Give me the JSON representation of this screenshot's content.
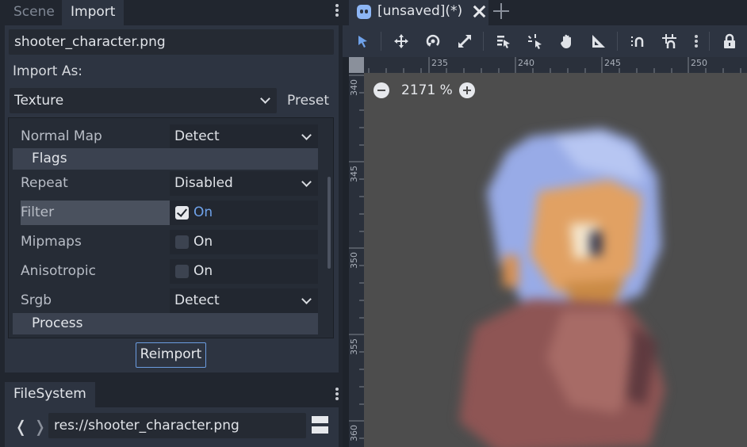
{
  "left_dock": {
    "tabs": [
      "Scene",
      "Import"
    ],
    "active_tab": "Import",
    "file_name": "shooter_character.png",
    "import_as_label": "Import As:",
    "import_as_value": "Texture",
    "preset_label": "Preset",
    "properties": {
      "normal_map": {
        "name": "Normal Map",
        "value": "Detect"
      },
      "flags_section": "Flags",
      "repeat": {
        "name": "Repeat",
        "value": "Disabled"
      },
      "filter": {
        "name": "Filter",
        "value": "On",
        "checked": true
      },
      "mipmaps": {
        "name": "Mipmaps",
        "value": "On",
        "checked": false
      },
      "anisotropic": {
        "name": "Anisotropic",
        "value": "On",
        "checked": false
      },
      "srgb": {
        "name": "Srgb",
        "value": "Detect"
      },
      "process_section": "Process"
    },
    "reimport_label": "Reimport"
  },
  "filesystem": {
    "tab_label": "FileSystem",
    "path": "res://shooter_character.png"
  },
  "editor": {
    "scene_tab_label": "[unsaved](*)",
    "zoom_label": "2171 %",
    "ruler_h_labels": [
      "235",
      "240",
      "245",
      "250"
    ],
    "ruler_v_labels": [
      "340",
      "345",
      "350",
      "355",
      "360"
    ]
  },
  "toolbar_icons": [
    "select-icon",
    "move-icon",
    "rotate-icon",
    "scale-icon",
    "list-select-icon",
    "pivot-icon",
    "pan-icon",
    "ruler-icon",
    "smart-snap-icon",
    "grid-snap-icon",
    "more-icon",
    "lock-icon"
  ],
  "colors": {
    "accent": "#6fa2ea",
    "panel_bg": "#2d3441",
    "canvas_bg": "#4d4d4d"
  }
}
